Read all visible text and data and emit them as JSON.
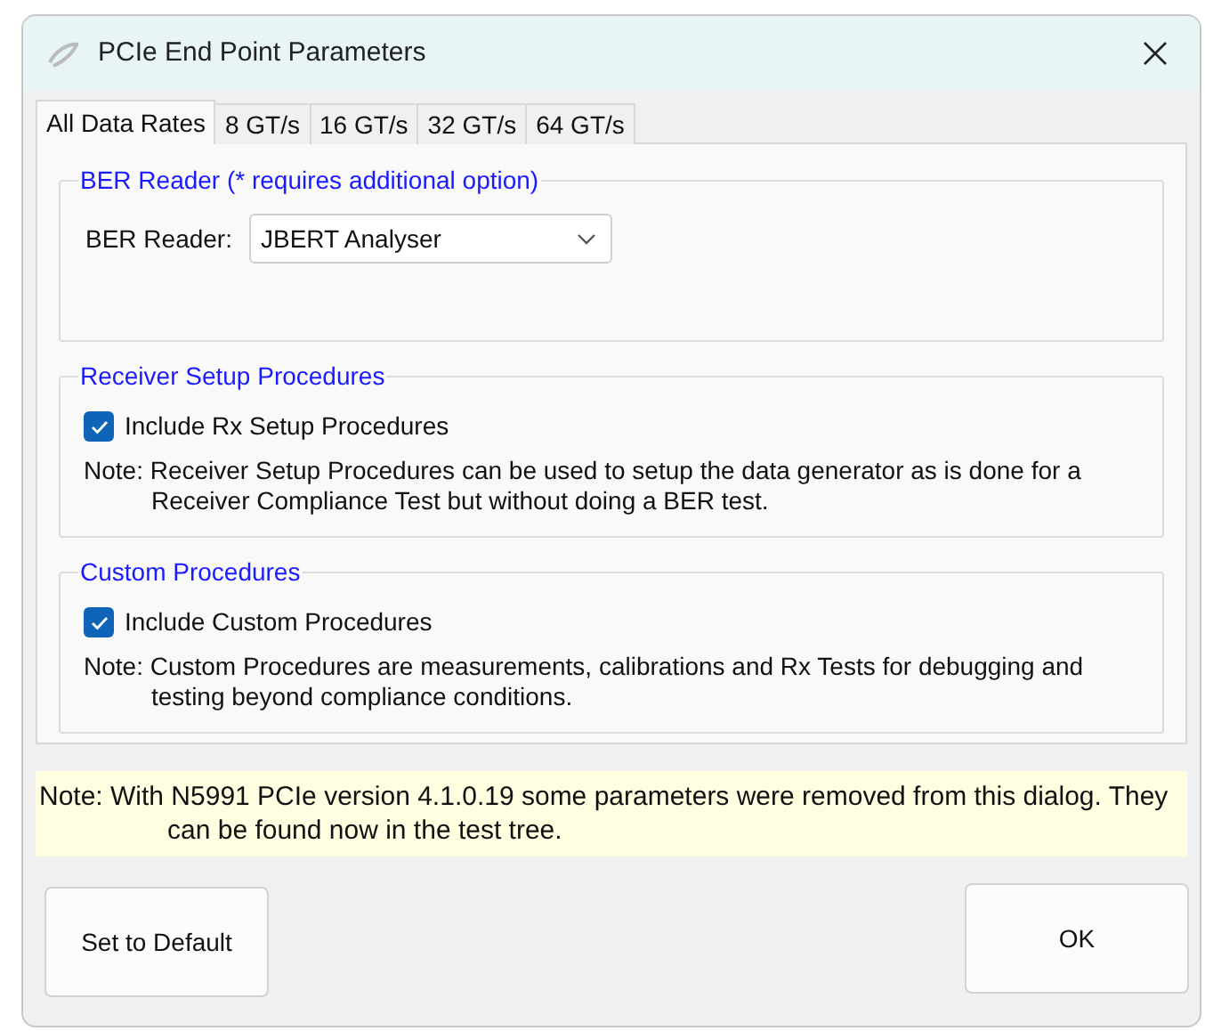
{
  "window": {
    "title": "PCIe End Point Parameters"
  },
  "tabs": [
    {
      "label": "All Data Rates",
      "selected": true
    },
    {
      "label": "8 GT/s",
      "selected": false
    },
    {
      "label": "16 GT/s",
      "selected": false
    },
    {
      "label": "32 GT/s",
      "selected": false
    },
    {
      "label": "64 GT/s",
      "selected": false
    }
  ],
  "groups": [
    {
      "kind": "dropdown",
      "title": "BER Reader (* requires additional option)",
      "label": "BER Reader:",
      "value": "JBERT Analyser"
    },
    {
      "kind": "checkbox",
      "title": "Receiver Setup Procedures",
      "checkbox": {
        "label": "Include Rx Setup Procedures",
        "checked": true
      },
      "note": "Note: Receiver Setup Procedures can be used to setup the data generator as is done for a Receiver Compliance Test but without doing a BER test."
    },
    {
      "kind": "checkbox",
      "title": "Custom Procedures",
      "checkbox": {
        "label": "Include Custom Procedures",
        "checked": true
      },
      "note": "Note:  Custom Procedures are measurements, calibrations and Rx Tests for debugging and testing beyond compliance conditions."
    }
  ],
  "note": "Note: With N5991 PCIe version 4.1.0.19 some parameters were removed from this dialog. They can be found now in the test tree.",
  "buttons": {
    "default": "Set to Default",
    "ok": "OK"
  }
}
